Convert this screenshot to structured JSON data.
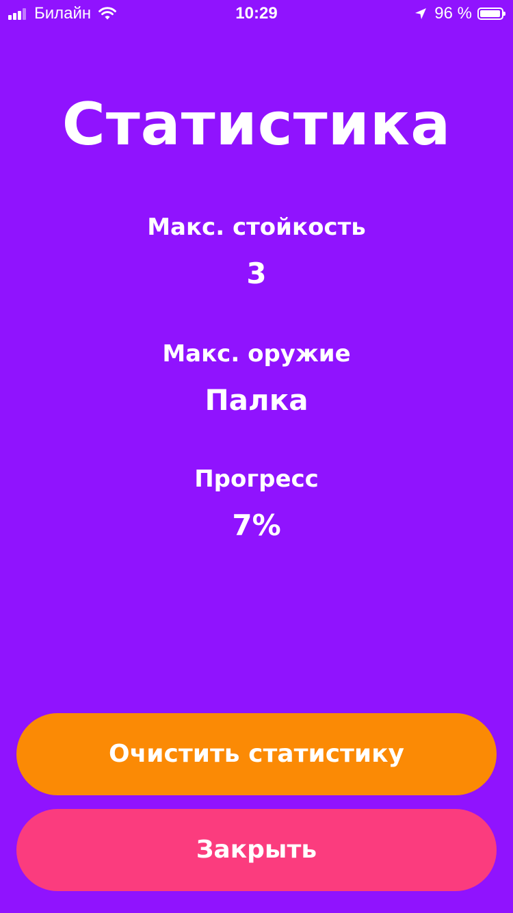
{
  "status_bar": {
    "carrier": "Билайн",
    "time": "10:29",
    "battery_text": "96 %",
    "battery_level": 0.96,
    "signal_bars_filled": 3,
    "signal_bars_total": 4,
    "icons": [
      "signal-icon",
      "wifi-icon",
      "location-arrow-icon",
      "battery-icon"
    ]
  },
  "title": "Статистика",
  "stats": [
    {
      "label": "Макс. стойкость",
      "value": "3"
    },
    {
      "label": "Макс. оружие",
      "value": "Палка"
    },
    {
      "label": "Прогресс",
      "value": "7%"
    }
  ],
  "buttons": {
    "clear_label": "Очистить статистику",
    "close_label": "Закрыть"
  },
  "colors": {
    "background": "#9013FE",
    "clear_button": "#FB8A05",
    "close_button": "#FB3C7E",
    "text": "#FFFFFF"
  }
}
